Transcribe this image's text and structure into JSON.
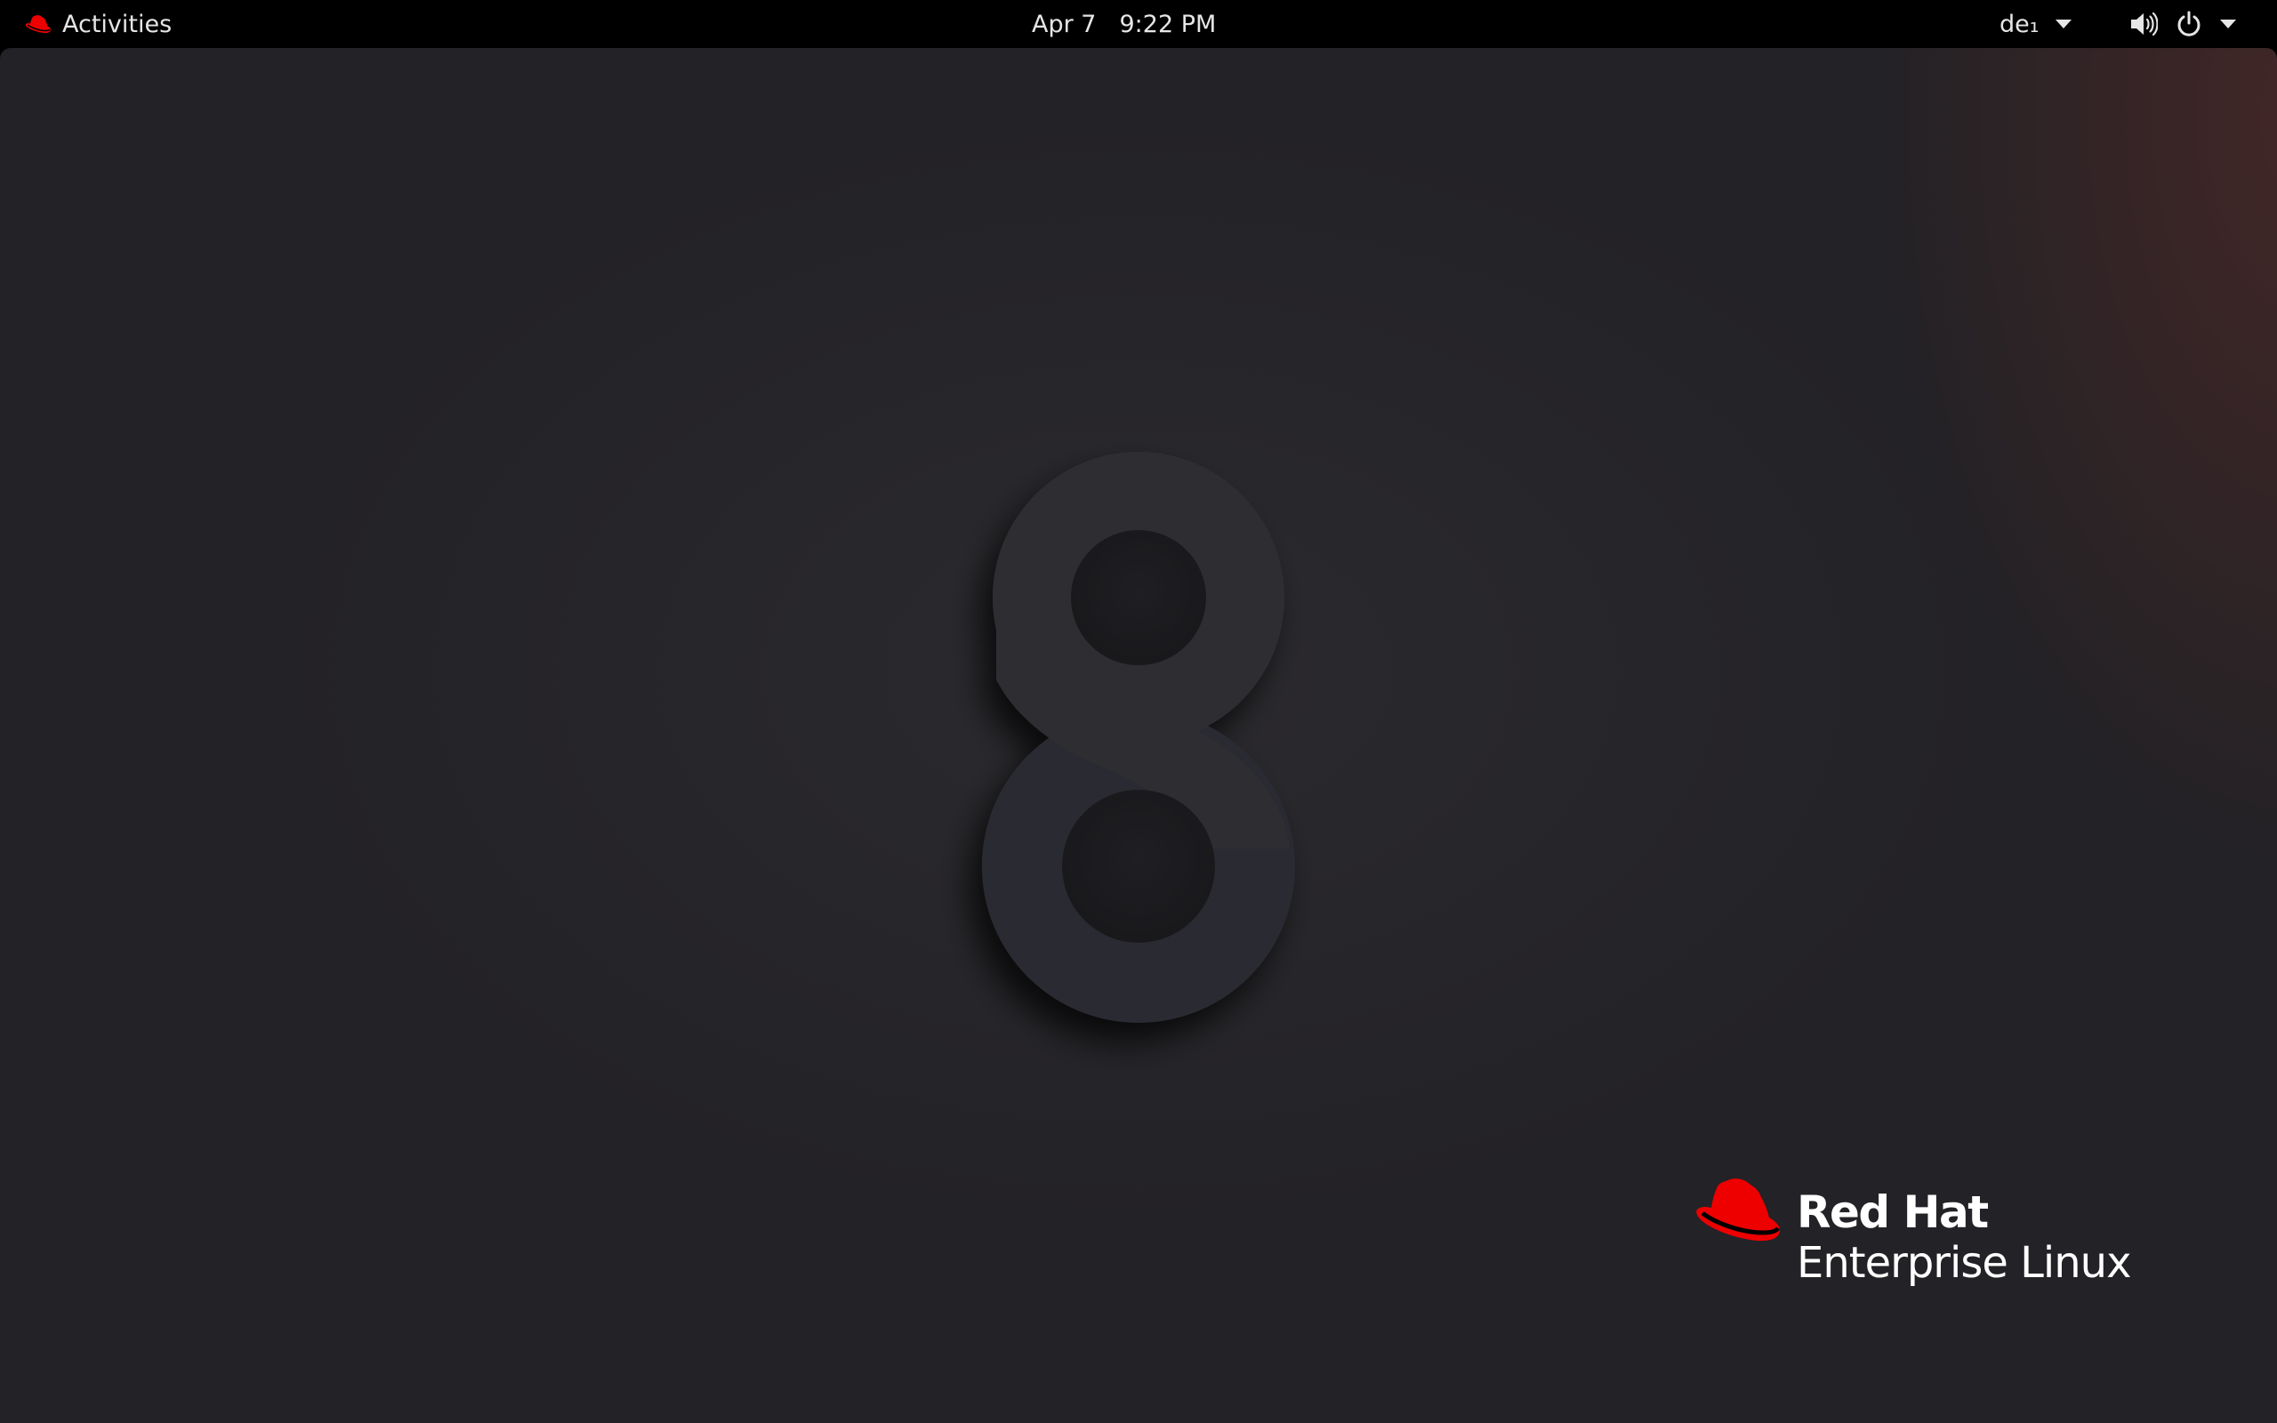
{
  "topbar": {
    "activities_label": "Activities",
    "activities_icon": "redhat-hat-icon",
    "clock_date": "Apr 7",
    "clock_time": "9:22 PM",
    "keyboard_layout": "de₁",
    "volume_icon": "speaker-volume-icon",
    "power_icon": "power-icon"
  },
  "desktop": {
    "wallpaper_numeral": "8",
    "logo": {
      "line1": "Red Hat",
      "line2": "Enterprise Linux"
    }
  },
  "colors": {
    "topbar_bg": "#000000",
    "topbar_text": "#e6e6e6",
    "desktop_bg": "#242327",
    "accent_red": "#ee0000",
    "numeral": "#2e2e32"
  }
}
